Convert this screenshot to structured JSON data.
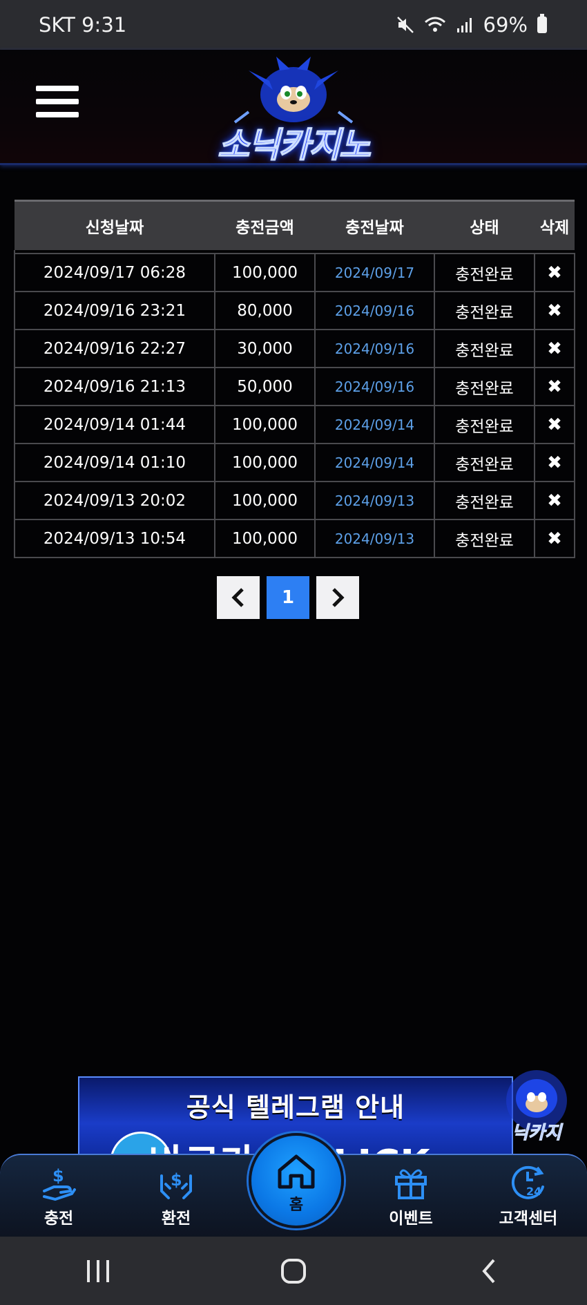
{
  "status_bar": {
    "carrier_time": "SKT 9:31",
    "battery": "69%"
  },
  "header": {
    "logo_text": "소닉카지노"
  },
  "table": {
    "headers": [
      "신청날짜",
      "충전금액",
      "충전날짜",
      "상태",
      "삭제"
    ],
    "rows": [
      {
        "request_date": "2024/09/17 06:28",
        "amount": "100,000",
        "charge_date": "2024/09/17",
        "status": "충전완료",
        "delete": "✖"
      },
      {
        "request_date": "2024/09/16 23:21",
        "amount": "80,000",
        "charge_date": "2024/09/16",
        "status": "충전완료",
        "delete": "✖"
      },
      {
        "request_date": "2024/09/16 22:27",
        "amount": "30,000",
        "charge_date": "2024/09/16",
        "status": "충전완료",
        "delete": "✖"
      },
      {
        "request_date": "2024/09/16 21:13",
        "amount": "50,000",
        "charge_date": "2024/09/16",
        "status": "충전완료",
        "delete": "✖"
      },
      {
        "request_date": "2024/09/14 01:44",
        "amount": "100,000",
        "charge_date": "2024/09/14",
        "status": "충전완료",
        "delete": "✖"
      },
      {
        "request_date": "2024/09/14 01:10",
        "amount": "100,000",
        "charge_date": "2024/09/14",
        "status": "충전완료",
        "delete": "✖"
      },
      {
        "request_date": "2024/09/13 20:02",
        "amount": "100,000",
        "charge_date": "2024/09/13",
        "status": "충전완료",
        "delete": "✖"
      },
      {
        "request_date": "2024/09/13 10:54",
        "amount": "100,000",
        "charge_date": "2024/09/13",
        "status": "충전완료",
        "delete": "✖"
      }
    ]
  },
  "pagination": {
    "prev": "‹",
    "current": "1",
    "next": "›"
  },
  "banner": {
    "title": "공식 텔레그램 안내",
    "subtitle": "바로가기 CLICK"
  },
  "bottom_nav": {
    "charge": "충전",
    "exchange": "환전",
    "home": "홈",
    "event": "이벤트",
    "support": "고객센터"
  },
  "colors": {
    "accent": "#2d7ff3",
    "charge_date_text": "#5da0e8",
    "header_bg": "#3b3b3e"
  }
}
